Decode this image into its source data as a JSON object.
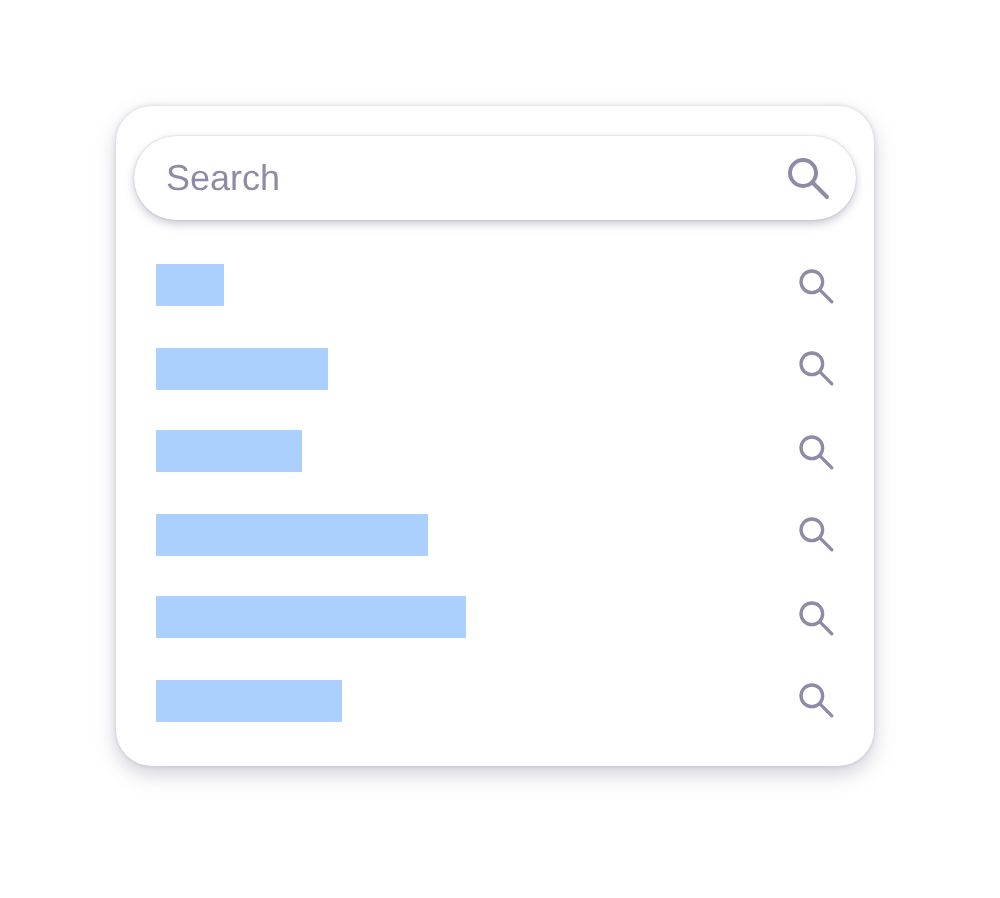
{
  "search": {
    "placeholder": "Search"
  },
  "results": [
    {
      "kind": "placeholder"
    },
    {
      "kind": "placeholder"
    },
    {
      "kind": "placeholder"
    },
    {
      "kind": "placeholder"
    },
    {
      "kind": "placeholder"
    },
    {
      "kind": "placeholder"
    }
  ]
}
